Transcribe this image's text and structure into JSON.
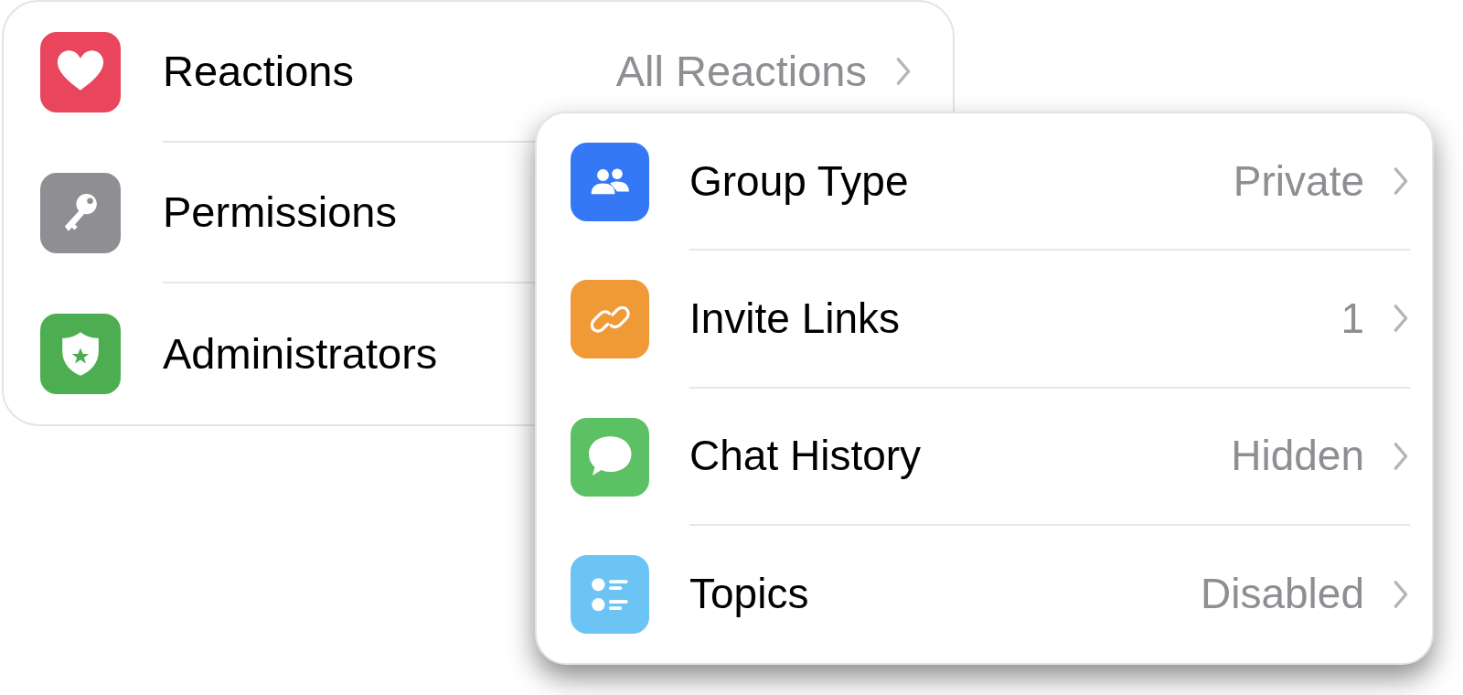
{
  "back_panel": {
    "items": [
      {
        "kind": "heart",
        "label": "Reactions",
        "value": "All Reactions",
        "color": "#e9455c"
      },
      {
        "kind": "key",
        "label": "Permissions",
        "color": "#8e8e93"
      },
      {
        "kind": "shield",
        "label": "Administrators",
        "color": "#4cae50"
      }
    ]
  },
  "front_panel": {
    "items": [
      {
        "kind": "people",
        "label": "Group Type",
        "value": "Private",
        "color": "#3478f6"
      },
      {
        "kind": "link",
        "label": "Invite Links",
        "value": "1",
        "color": "#f09a37"
      },
      {
        "kind": "bubble",
        "label": "Chat History",
        "value": "Hidden",
        "color": "#5cc064"
      },
      {
        "kind": "list",
        "label": "Topics",
        "value": "Disabled",
        "color": "#6cc4f4"
      }
    ]
  }
}
